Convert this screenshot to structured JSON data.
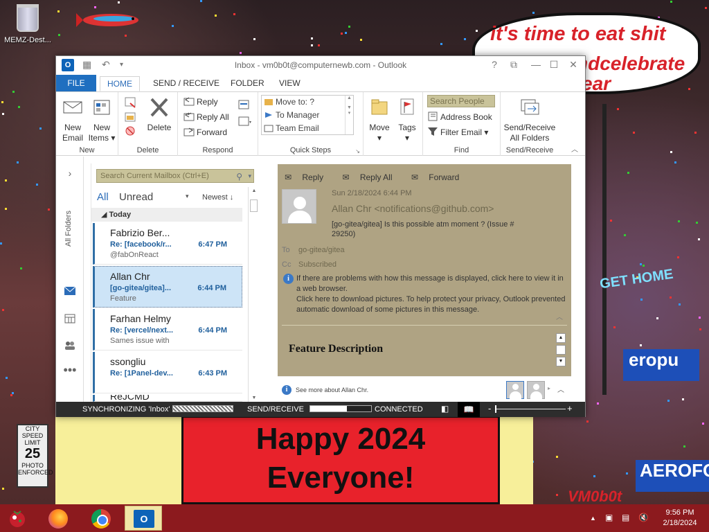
{
  "desktop": {
    "recycle_bin_label": "MEMZ-Dest...",
    "bubble_line1": "it's time to eat shit",
    "bubble_line2": "ndcelebrate",
    "bubble_line3": "ear",
    "banner_line1": "Happy 2024",
    "banner_line2": "Everyone!",
    "speed_sign": {
      "top": "CITY SPEED LIMIT",
      "value": "25",
      "bottom": "PHOTO ENFORCED"
    },
    "street_sign": "GET HOME",
    "neon_sign_1": "eropu",
    "neon_sign_2": "AEROFOS",
    "signature": "VM0b0t"
  },
  "window": {
    "title": "Inbox - vm0b0t@computernewb.com - Outlook",
    "controls": [
      "?",
      "⧉",
      "—",
      "☐",
      "✕"
    ]
  },
  "tabs": [
    {
      "label": "FILE"
    },
    {
      "label": "HOME"
    },
    {
      "label": "SEND / RECEIVE"
    },
    {
      "label": "FOLDER"
    },
    {
      "label": "VIEW"
    }
  ],
  "ribbon": {
    "new": {
      "new_email": "New Email",
      "new_items": "New Items",
      "group": "New"
    },
    "delete": {
      "delete": "Delete",
      "group": "Delete"
    },
    "respond": {
      "reply": "Reply",
      "reply_all": "Reply All",
      "forward": "Forward",
      "group": "Respond"
    },
    "quick_steps": {
      "items": [
        "Move to: ?",
        "To Manager",
        "Team Email"
      ],
      "group": "Quick Steps"
    },
    "move": {
      "move": "Move",
      "tags": "Tags"
    },
    "find": {
      "search_people_placeholder": "Search People",
      "address_book": "Address Book",
      "filter_email": "Filter Email",
      "group": "Find"
    },
    "send_receive": {
      "label": "Send/Receive All Folders",
      "group": "Send/Receive"
    }
  },
  "navpane": {
    "all_folders": "All Folders"
  },
  "message_list": {
    "search_placeholder": "Search Current Mailbox (Ctrl+E)",
    "filter_all": "All",
    "filter_unread": "Unread",
    "sort": "Newest",
    "group_today": "Today",
    "messages": [
      {
        "from": "Fabrizio Ber...",
        "subject": "Re: [facebook/r...",
        "time": "6:47 PM",
        "preview": "@fabOnReact"
      },
      {
        "from": "Allan Chr",
        "subject": "[go-gitea/gitea]...",
        "time": "6:44 PM",
        "preview": "Feature"
      },
      {
        "from": "Farhan Helmy",
        "subject": "Re: [vercel/next...",
        "time": "6:44 PM",
        "preview": "Sames issue with"
      },
      {
        "from": "ssongliu",
        "subject": "Re: [1Panel-dev...",
        "time": "6:43 PM",
        "preview": ""
      },
      {
        "from": "ReJCMD",
        "subject": "",
        "time": "",
        "preview": ""
      }
    ]
  },
  "reading": {
    "actions": [
      "Reply",
      "Reply All",
      "Forward"
    ],
    "date": "Sun 2/18/2024 6:44 PM",
    "from": "Allan Chr <notifications@github.com>",
    "subject": "[go-gitea/gitea] Is this possible atm moment ? (Issue # 29250)",
    "to_label": "To",
    "to": "go-gitea/gitea",
    "cc_label": "Cc",
    "cc": "Subscribed",
    "info_line1": "If there are problems with how this message is displayed, click here to view it in a web browser.",
    "info_line2": "Click here to download pictures. To help protect your privacy, Outlook prevented automatic download of some pictures in this message.",
    "body_title": "Feature Description",
    "see_more": "See more about Allan Chr."
  },
  "statusbar": {
    "sync": "SYNCHRONIZING 'Inbox'",
    "send_receive": "SEND/RECEIVE",
    "send_receive_progress": 0.6,
    "connected": "CONNECTED"
  },
  "taskbar": {
    "time": "9:56 PM",
    "date": "2/18/2024"
  },
  "colors": {
    "accent": "#1f6fc0",
    "reading_bg": "#afa383",
    "taskbar": "#8c1a1e"
  }
}
